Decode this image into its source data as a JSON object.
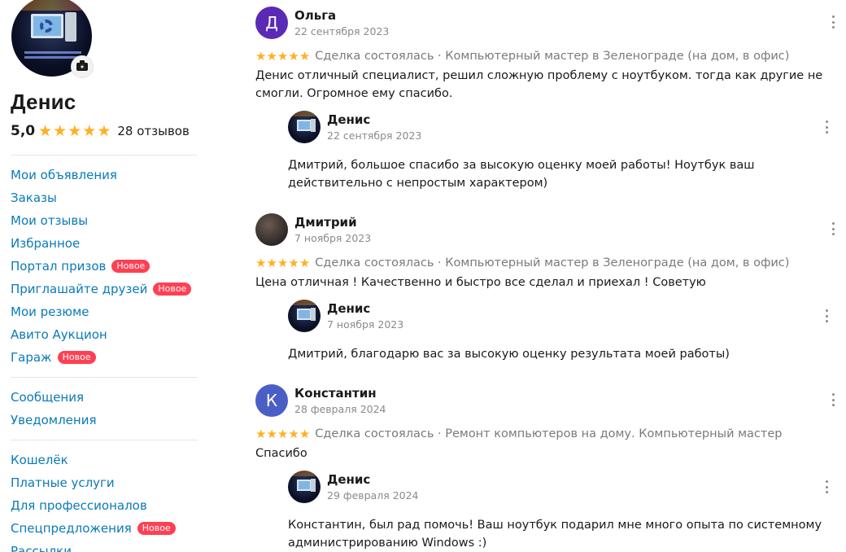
{
  "profile": {
    "name": "Денис",
    "rating": "5,0",
    "stars": 5,
    "reviews_count": "28 отзывов"
  },
  "menu": {
    "group1": [
      {
        "label": "Мои объявления",
        "badge": null
      },
      {
        "label": "Заказы",
        "badge": null
      },
      {
        "label": "Мои отзывы",
        "badge": null
      },
      {
        "label": "Избранное",
        "badge": null
      },
      {
        "label": "Портал призов",
        "badge": "Новое"
      },
      {
        "label": "Приглашайте друзей",
        "badge": "Новое"
      },
      {
        "label": "Мои резюме",
        "badge": null
      },
      {
        "label": "Авито Аукцион",
        "badge": null
      },
      {
        "label": "Гараж",
        "badge": "Новое"
      }
    ],
    "group2": [
      {
        "label": "Сообщения",
        "badge": null
      },
      {
        "label": "Уведомления",
        "badge": null
      }
    ],
    "group3": [
      {
        "label": "Кошелёк",
        "badge": null
      },
      {
        "label": "Платные услуги",
        "badge": null
      },
      {
        "label": "Для профессионалов",
        "badge": null
      },
      {
        "label": "Спецпредложения",
        "badge": "Новое"
      },
      {
        "label": "Рассылки",
        "badge": null
      }
    ]
  },
  "reviews": [
    {
      "author": "Ольга",
      "initial": "Д",
      "avatar_color": "#5a2ab5",
      "date": "22 сентября 2023",
      "stars": 5,
      "deal": "Сделка состоялась · Компьютерный мастер в Зеленограде (на дом, в офис)",
      "text": "Денис отличный специалист, решил сложную проблему с ноутбуком. тогда как другие не смогли. Огромное ему спасибо.",
      "reply": {
        "author": "Денис",
        "date": "22 сентября 2023",
        "text": "Дмитрий, большое спасибо за высокую оценку моей работы! Ноутбук ваш действительно с непростым характером)"
      }
    },
    {
      "author": "Дмитрий",
      "initial": "",
      "avatar_color": "#3a3330",
      "date": "7 ноября 2023",
      "stars": 5,
      "deal": "Сделка состоялась · Компьютерный мастер в Зеленограде (на дом, в офис)",
      "text": "Цена отличная ! Качественно и быстро все сделал и приехал ! Советую",
      "reply": {
        "author": "Денис",
        "date": "7 ноября 2023",
        "text": "Дмитрий, благодарю вас за высокую оценку результата моей работы)"
      }
    },
    {
      "author": "Константин",
      "initial": "К",
      "avatar_color": "#4a5fc6",
      "date": "28 февраля 2024",
      "stars": 5,
      "deal": "Сделка состоялась · Ремонт компьютеров на дому. Компьютерный мастер",
      "text": "Спасибо",
      "reply": {
        "author": "Денис",
        "date": "29 февраля 2024",
        "text": "Константин, был рад помочь! Ваш ноутбук подарил мне много опыта по системному администрированию Windows :)"
      }
    }
  ]
}
